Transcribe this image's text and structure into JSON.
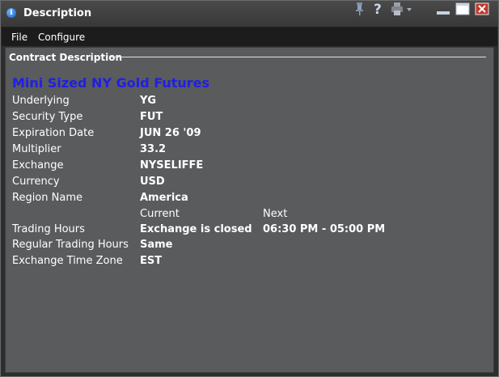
{
  "window": {
    "title": "Description",
    "icons": [
      "info-icon",
      "pin-icon",
      "help-icon",
      "print-icon",
      "minimize-icon",
      "maximize-icon",
      "close-icon"
    ]
  },
  "menu": {
    "file": "File",
    "configure": "Configure"
  },
  "section": {
    "title": "Contract Description"
  },
  "contract": {
    "name": "Mini Sized NY Gold Futures",
    "rows": [
      {
        "label": "Underlying",
        "value": "YG"
      },
      {
        "label": "Security Type",
        "value": "FUT"
      },
      {
        "label": "Expiration Date",
        "value": "JUN 26 '09"
      },
      {
        "label": "Multiplier",
        "value": "33.2"
      },
      {
        "label": "Exchange",
        "value": "NYSELIFFE"
      },
      {
        "label": "Currency",
        "value": "USD"
      },
      {
        "label": "Region Name",
        "value": "America"
      }
    ],
    "columns": {
      "current": "Current",
      "next": "Next"
    },
    "trading_hours": {
      "label": "Trading Hours",
      "current": "Exchange is closed",
      "next": "06:30 PM - 05:00 PM"
    },
    "regular_trading_hours": {
      "label": "Regular Trading Hours",
      "current": "Same"
    },
    "time_zone": {
      "label": "Exchange Time Zone",
      "current": "EST"
    }
  },
  "colors": {
    "heading": "#1f1fe6",
    "panel": "#5a5b5d",
    "close": "#c0392b"
  }
}
